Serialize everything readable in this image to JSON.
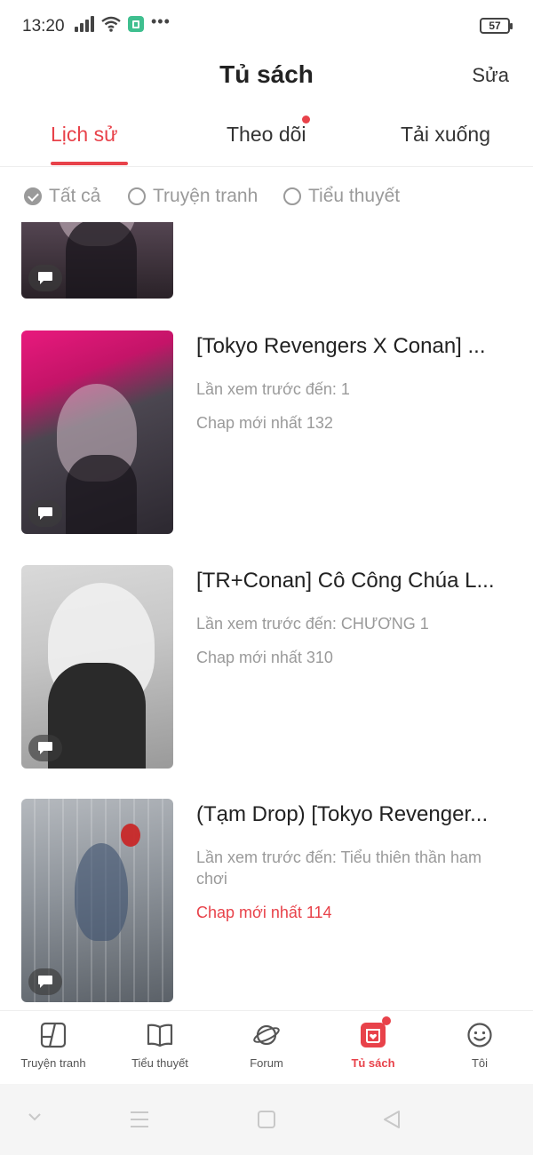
{
  "status_bar": {
    "time": "13:20",
    "battery": "57",
    "icons": [
      "signal-icon",
      "wifi-icon",
      "app-notification-icon",
      "more-dots-icon"
    ]
  },
  "header": {
    "title": "Tủ sách",
    "edit_label": "Sửa"
  },
  "tabs": [
    {
      "label": "Lịch sử",
      "active": true
    },
    {
      "label": "Theo dõi",
      "has_dot": true
    },
    {
      "label": "Tải xuống"
    }
  ],
  "filters": [
    {
      "label": "Tất cả",
      "checked": true
    },
    {
      "label": "Truyện tranh",
      "checked": false
    },
    {
      "label": "Tiểu thuyết",
      "checked": false
    }
  ],
  "items": [
    {
      "title": "[Tokyo Revengers X Conan] ...",
      "last_read": "Lần xem trước đến: 1",
      "latest_chapter": "Chap mới nhất 132",
      "latest_highlight": false
    },
    {
      "title": "[TR+Conan] Cô Công Chúa L...",
      "last_read": "Lần xem trước đến: CHƯƠNG 1",
      "latest_chapter": "Chap mới nhất 310",
      "latest_highlight": false
    },
    {
      "title": "(Tạm Drop) [Tokyo Revenger...",
      "last_read": "Lần xem trước đến: Tiểu thiên thần ham chơi",
      "latest_chapter": "Chap mới nhất 114",
      "latest_highlight": true
    }
  ],
  "bottom_nav": [
    {
      "label": "Truyện tranh",
      "icon": "comic-icon"
    },
    {
      "label": "Tiểu thuyết",
      "icon": "book-icon"
    },
    {
      "label": "Forum",
      "icon": "planet-icon"
    },
    {
      "label": "Tủ sách",
      "icon": "bookshelf-icon",
      "active": true,
      "has_dot": true
    },
    {
      "label": "Tôi",
      "icon": "smiley-icon"
    }
  ],
  "system_nav": [
    "chevron-down-icon",
    "menu-icon",
    "home-square-icon",
    "back-triangle-icon"
  ],
  "colors": {
    "accent": "#e8424a",
    "muted_text": "#9a9a9a"
  }
}
